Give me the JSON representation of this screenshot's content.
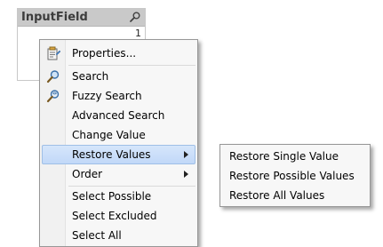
{
  "listbox": {
    "title": "InputField",
    "row_value": "1"
  },
  "context_menu": {
    "items": [
      {
        "label": "Properties...",
        "icon": "properties-icon"
      },
      {
        "label": "Search",
        "icon": "search-icon"
      },
      {
        "label": "Fuzzy Search",
        "icon": "fuzzy-search-icon"
      },
      {
        "label": "Advanced Search"
      },
      {
        "label": "Change Value"
      },
      {
        "label": "Restore Values",
        "has_submenu": true,
        "highlighted": true
      },
      {
        "label": "Order",
        "has_submenu": true
      },
      {
        "label": "Select Possible"
      },
      {
        "label": "Select Excluded"
      },
      {
        "label": "Select All"
      }
    ]
  },
  "submenu": {
    "items": [
      {
        "label": "Restore Single Value"
      },
      {
        "label": "Restore Possible Values"
      },
      {
        "label": "Restore All Values"
      }
    ]
  },
  "colors": {
    "highlight_bg": "#c8dcf8",
    "highlight_border": "#9fbfe6",
    "menu_bg": "#f7f7f7",
    "header_bg": "#c9c9c9"
  }
}
